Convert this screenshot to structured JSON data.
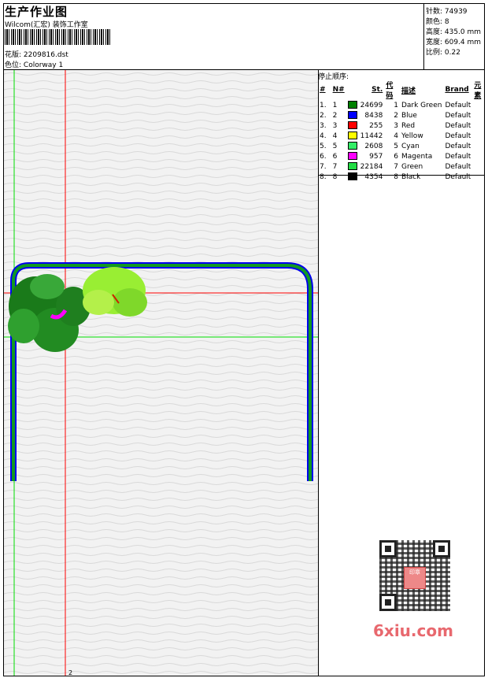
{
  "header": {
    "title": "生产作业图",
    "subtitle": "Wilcom(汇宏) 装饰工作室",
    "design_label": "花版:",
    "design_value": "2209816.dst",
    "colorway_label": "色位:",
    "colorway_value": "Colorway 1"
  },
  "stats": {
    "stitches": "针数: 74939",
    "colors": "颜色: 8",
    "height": "高度: 435.0 mm",
    "width": "宽度: 609.4 mm",
    "scale": "比例: 0.22"
  },
  "sequence": {
    "title": "停止顺序:",
    "headers": [
      "#",
      "N#",
      "St.",
      "代码",
      "描述",
      "Brand",
      "元素"
    ],
    "rows": [
      {
        "num": "1.",
        "n": "1",
        "color": "#008000",
        "st": "24699",
        "code": "1",
        "desc": "Dark Green",
        "brand": "Default"
      },
      {
        "num": "2.",
        "n": "2",
        "color": "#0000ff",
        "st": "8438",
        "code": "2",
        "desc": "Blue",
        "brand": "Default"
      },
      {
        "num": "3.",
        "n": "3",
        "color": "#ff0000",
        "st": "255",
        "code": "3",
        "desc": "Red",
        "brand": "Default"
      },
      {
        "num": "4.",
        "n": "4",
        "color": "#ffff00",
        "st": "11442",
        "code": "4",
        "desc": "Yellow",
        "brand": "Default"
      },
      {
        "num": "5.",
        "n": "5",
        "color": "#33ee66",
        "st": "2608",
        "code": "5",
        "desc": "Cyan",
        "brand": "Default"
      },
      {
        "num": "6.",
        "n": "6",
        "color": "#ff00ff",
        "st": "957",
        "code": "6",
        "desc": "Magenta",
        "brand": "Default"
      },
      {
        "num": "7.",
        "n": "7",
        "color": "#22dd44",
        "st": "22184",
        "code": "7",
        "desc": "Green",
        "brand": "Default"
      },
      {
        "num": "8.",
        "n": "8",
        "color": "#000000",
        "st": "4354",
        "code": "8",
        "desc": "Black",
        "brand": "Default"
      }
    ]
  },
  "watermark": {
    "brand": "6xiu.com",
    "seal": "印章"
  },
  "canvas": {
    "marker": "2"
  }
}
